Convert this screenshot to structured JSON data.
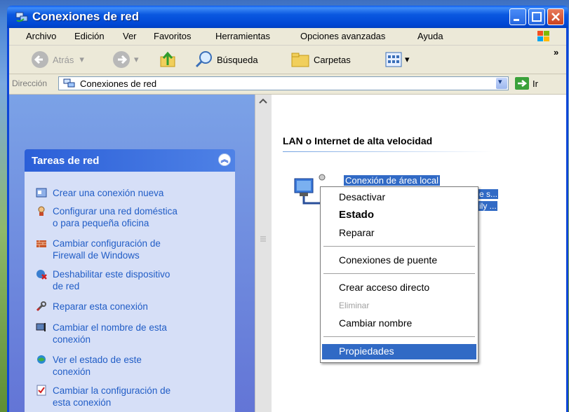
{
  "window": {
    "title": "Conexiones de red"
  },
  "menubar": {
    "items": [
      "Archivo",
      "Edición",
      "Ver",
      "Favoritos",
      "Herramientas",
      "Opciones avanzadas",
      "Ayuda"
    ]
  },
  "toolbar": {
    "back_label": "Atrás",
    "search_label": "Búsqueda",
    "folders_label": "Carpetas",
    "chevron": "»"
  },
  "addressbar": {
    "label": "Dirección",
    "value": "Conexiones de red",
    "go_label": "Ir"
  },
  "taskpane": {
    "header": "Tareas de red",
    "tasks": [
      {
        "line1": "Crear una conexión nueva",
        "line2": ""
      },
      {
        "line1": "Configurar una red doméstica",
        "line2": "o para pequeña oficina"
      },
      {
        "line1": "Cambiar configuración de",
        "line2": "Firewall de Windows"
      },
      {
        "line1": "Deshabilitar este dispositivo",
        "line2": "de red"
      },
      {
        "line1": "Reparar esta conexión",
        "line2": ""
      },
      {
        "line1": "Cambiar el nombre de esta",
        "line2": "conexión"
      },
      {
        "line1": "Ver el estado de este",
        "line2": "conexión"
      },
      {
        "line1": "Cambiar la configuración de",
        "line2": "esta conexión"
      }
    ]
  },
  "main": {
    "group_header": "LAN o Internet de alta velocidad",
    "connection": {
      "name": "Conexión de área local",
      "sub1": "e s...",
      "sub2": "ily ..."
    }
  },
  "context_menu": {
    "items": {
      "disable": "Desactivar",
      "status": "Estado",
      "repair": "Reparar",
      "bridge": "Conexiones de puente",
      "shortcut": "Crear acceso directo",
      "delete": "Eliminar",
      "rename": "Cambiar nombre",
      "properties": "Propiedades"
    }
  },
  "colors": {
    "titlebar": "#0a58e0",
    "selection": "#316ac5",
    "task_link": "#215dc6"
  }
}
